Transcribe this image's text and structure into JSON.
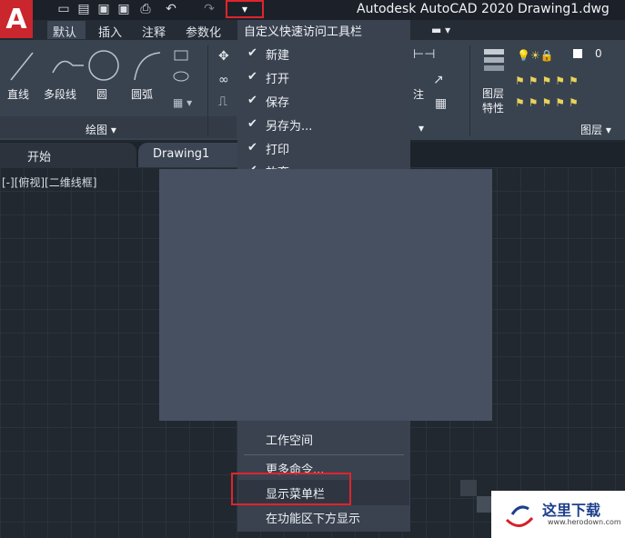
{
  "titlebar": {
    "app_title": "Autodesk AutoCAD 2020    Drawing1.dwg",
    "logo_letter": "A",
    "qat_dropdown_glyph": "▾"
  },
  "ribbon_tabs": [
    "默认",
    "插入",
    "注释",
    "参数化"
  ],
  "ribbon": {
    "draw_tools": [
      "直线",
      "多段线",
      "圆",
      "圆弧"
    ],
    "draw_panel": "绘图 ▾",
    "annotate_label": "注",
    "layer_tool": "图层\n特性",
    "layer_tool_line1": "图层",
    "layer_tool_line2": "特性",
    "layer_panel": "图层 ▾",
    "layer_number": "0"
  },
  "file_tabs": {
    "start": "开始",
    "drawing": "Drawing1"
  },
  "viewport_label": "[-][俯视][二维线框]",
  "menu": {
    "title": "自定义快速访问工具栏",
    "checked_items": [
      "新建",
      "打开",
      "保存",
      "另存为...",
      "打印",
      "放弃"
    ],
    "check_glyph": "✔",
    "bottom_items": [
      "工作空间",
      "更多命令...",
      "显示菜单栏",
      "在功能区下方显示"
    ]
  },
  "watermark": {
    "text": "这里下载",
    "url": "www.herodown.com"
  },
  "colors": {
    "accent_red": "#e0242b",
    "logo_red": "#c9262d",
    "menu_bg": "#3a4250",
    "canvas_bg": "#212830"
  }
}
